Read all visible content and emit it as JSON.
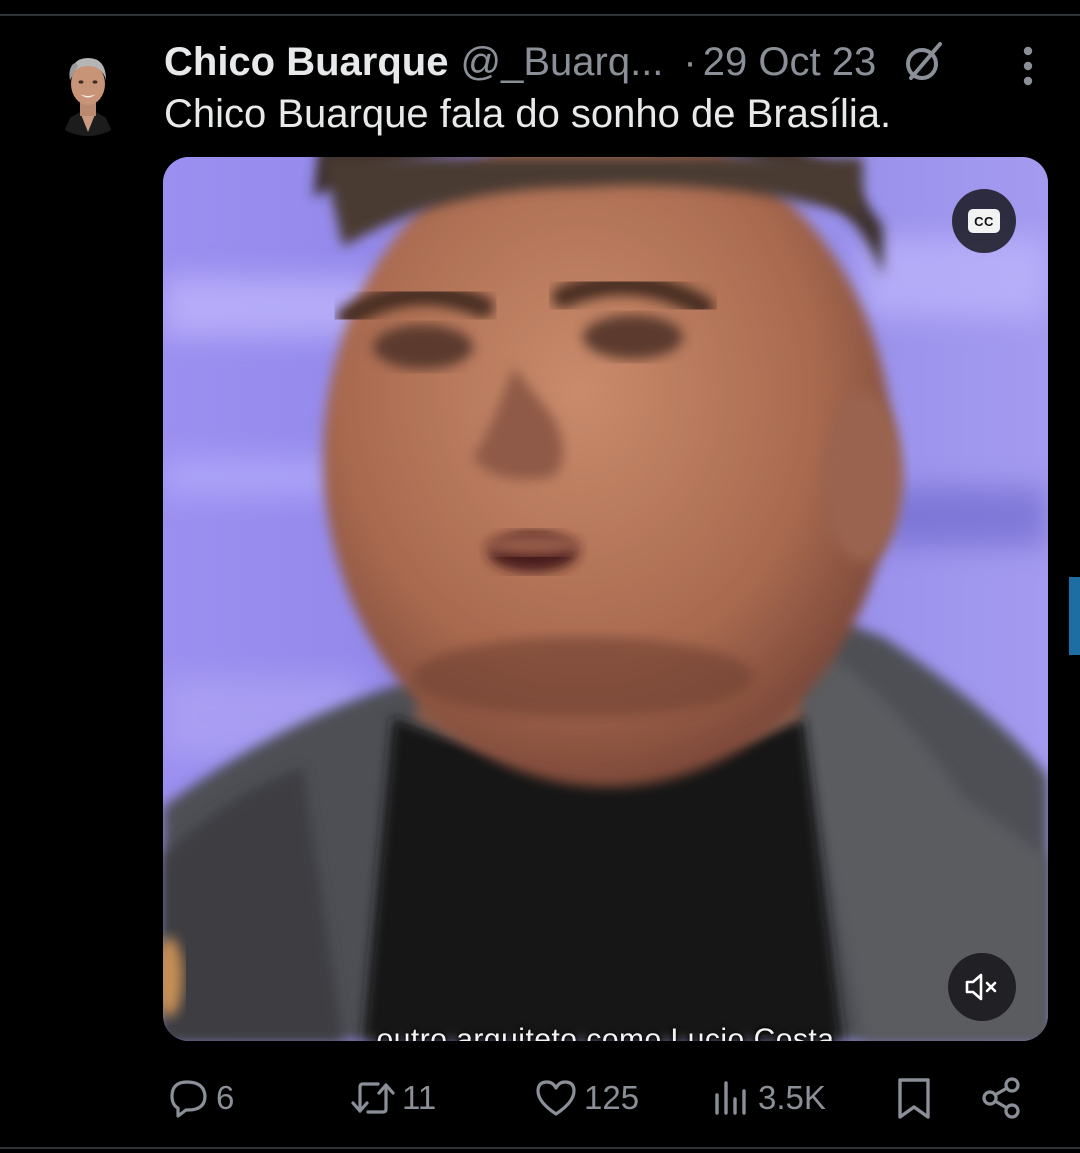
{
  "tweet": {
    "author": {
      "display_name": "Chico Buarque",
      "handle": "@_Buarq...",
      "avatar": "avatar-photo"
    },
    "separator": "·",
    "date": "29 Oct 23",
    "text": "Chico Buarque fala do sonho de Brasília.",
    "media": {
      "type": "video",
      "subtitle": "outro arquiteto como Lucio Costa",
      "cc_label": "CC",
      "mute_icon": "speaker-muted-icon"
    },
    "actions": {
      "replies": "6",
      "reposts": "11",
      "likes": "125",
      "views": "3.5K"
    }
  },
  "icons": {
    "reply": "reply-icon",
    "repost": "repost-icon",
    "like": "heart-icon",
    "views": "views-bar-chart-icon",
    "bookmark": "bookmark-icon",
    "share": "share-icon",
    "more": "more-vertical-icon",
    "grok": "grok-slash-icon"
  },
  "colors": {
    "background": "#000000",
    "primary_text": "#e7e9ea",
    "secondary_text": "#8b9098",
    "divider": "#2f3336",
    "video_background": "#8f86e8"
  }
}
